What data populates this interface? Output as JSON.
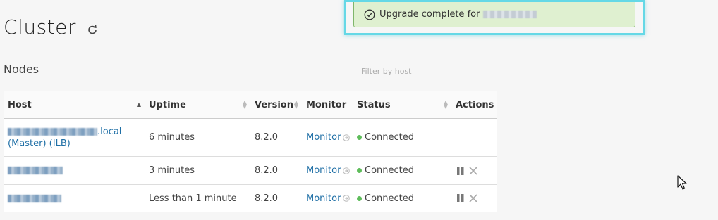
{
  "page": {
    "title": "Cluster",
    "section": "Nodes"
  },
  "toast": {
    "message": "Upgrade complete for"
  },
  "filter": {
    "placeholder": "Filter by host"
  },
  "table": {
    "columns": [
      "Host",
      "Uptime",
      "Version",
      "Monitor",
      "Status",
      "Actions"
    ],
    "rows": [
      {
        "host_suffix": ".local",
        "host_line2": "(Master) (ILB)",
        "uptime": "6 minutes",
        "version": "8.2.0",
        "monitor": "Monitor",
        "status": "Connected"
      },
      {
        "uptime": "3 minutes",
        "version": "8.2.0",
        "monitor": "Monitor",
        "status": "Connected"
      },
      {
        "uptime": "Less than 1 minute",
        "version": "8.2.0",
        "monitor": "Monitor",
        "status": "Connected"
      }
    ]
  },
  "colors": {
    "link": "#1f6fa6",
    "connected": "#5fbd5b",
    "toast_bg": "#dff0d0",
    "highlight": "#65d8e6"
  },
  "icons": [
    "refresh-icon",
    "check-circle-icon",
    "sort-icon",
    "external-arrow-icon",
    "pause-icon",
    "close-icon",
    "mouse-cursor-icon"
  ]
}
